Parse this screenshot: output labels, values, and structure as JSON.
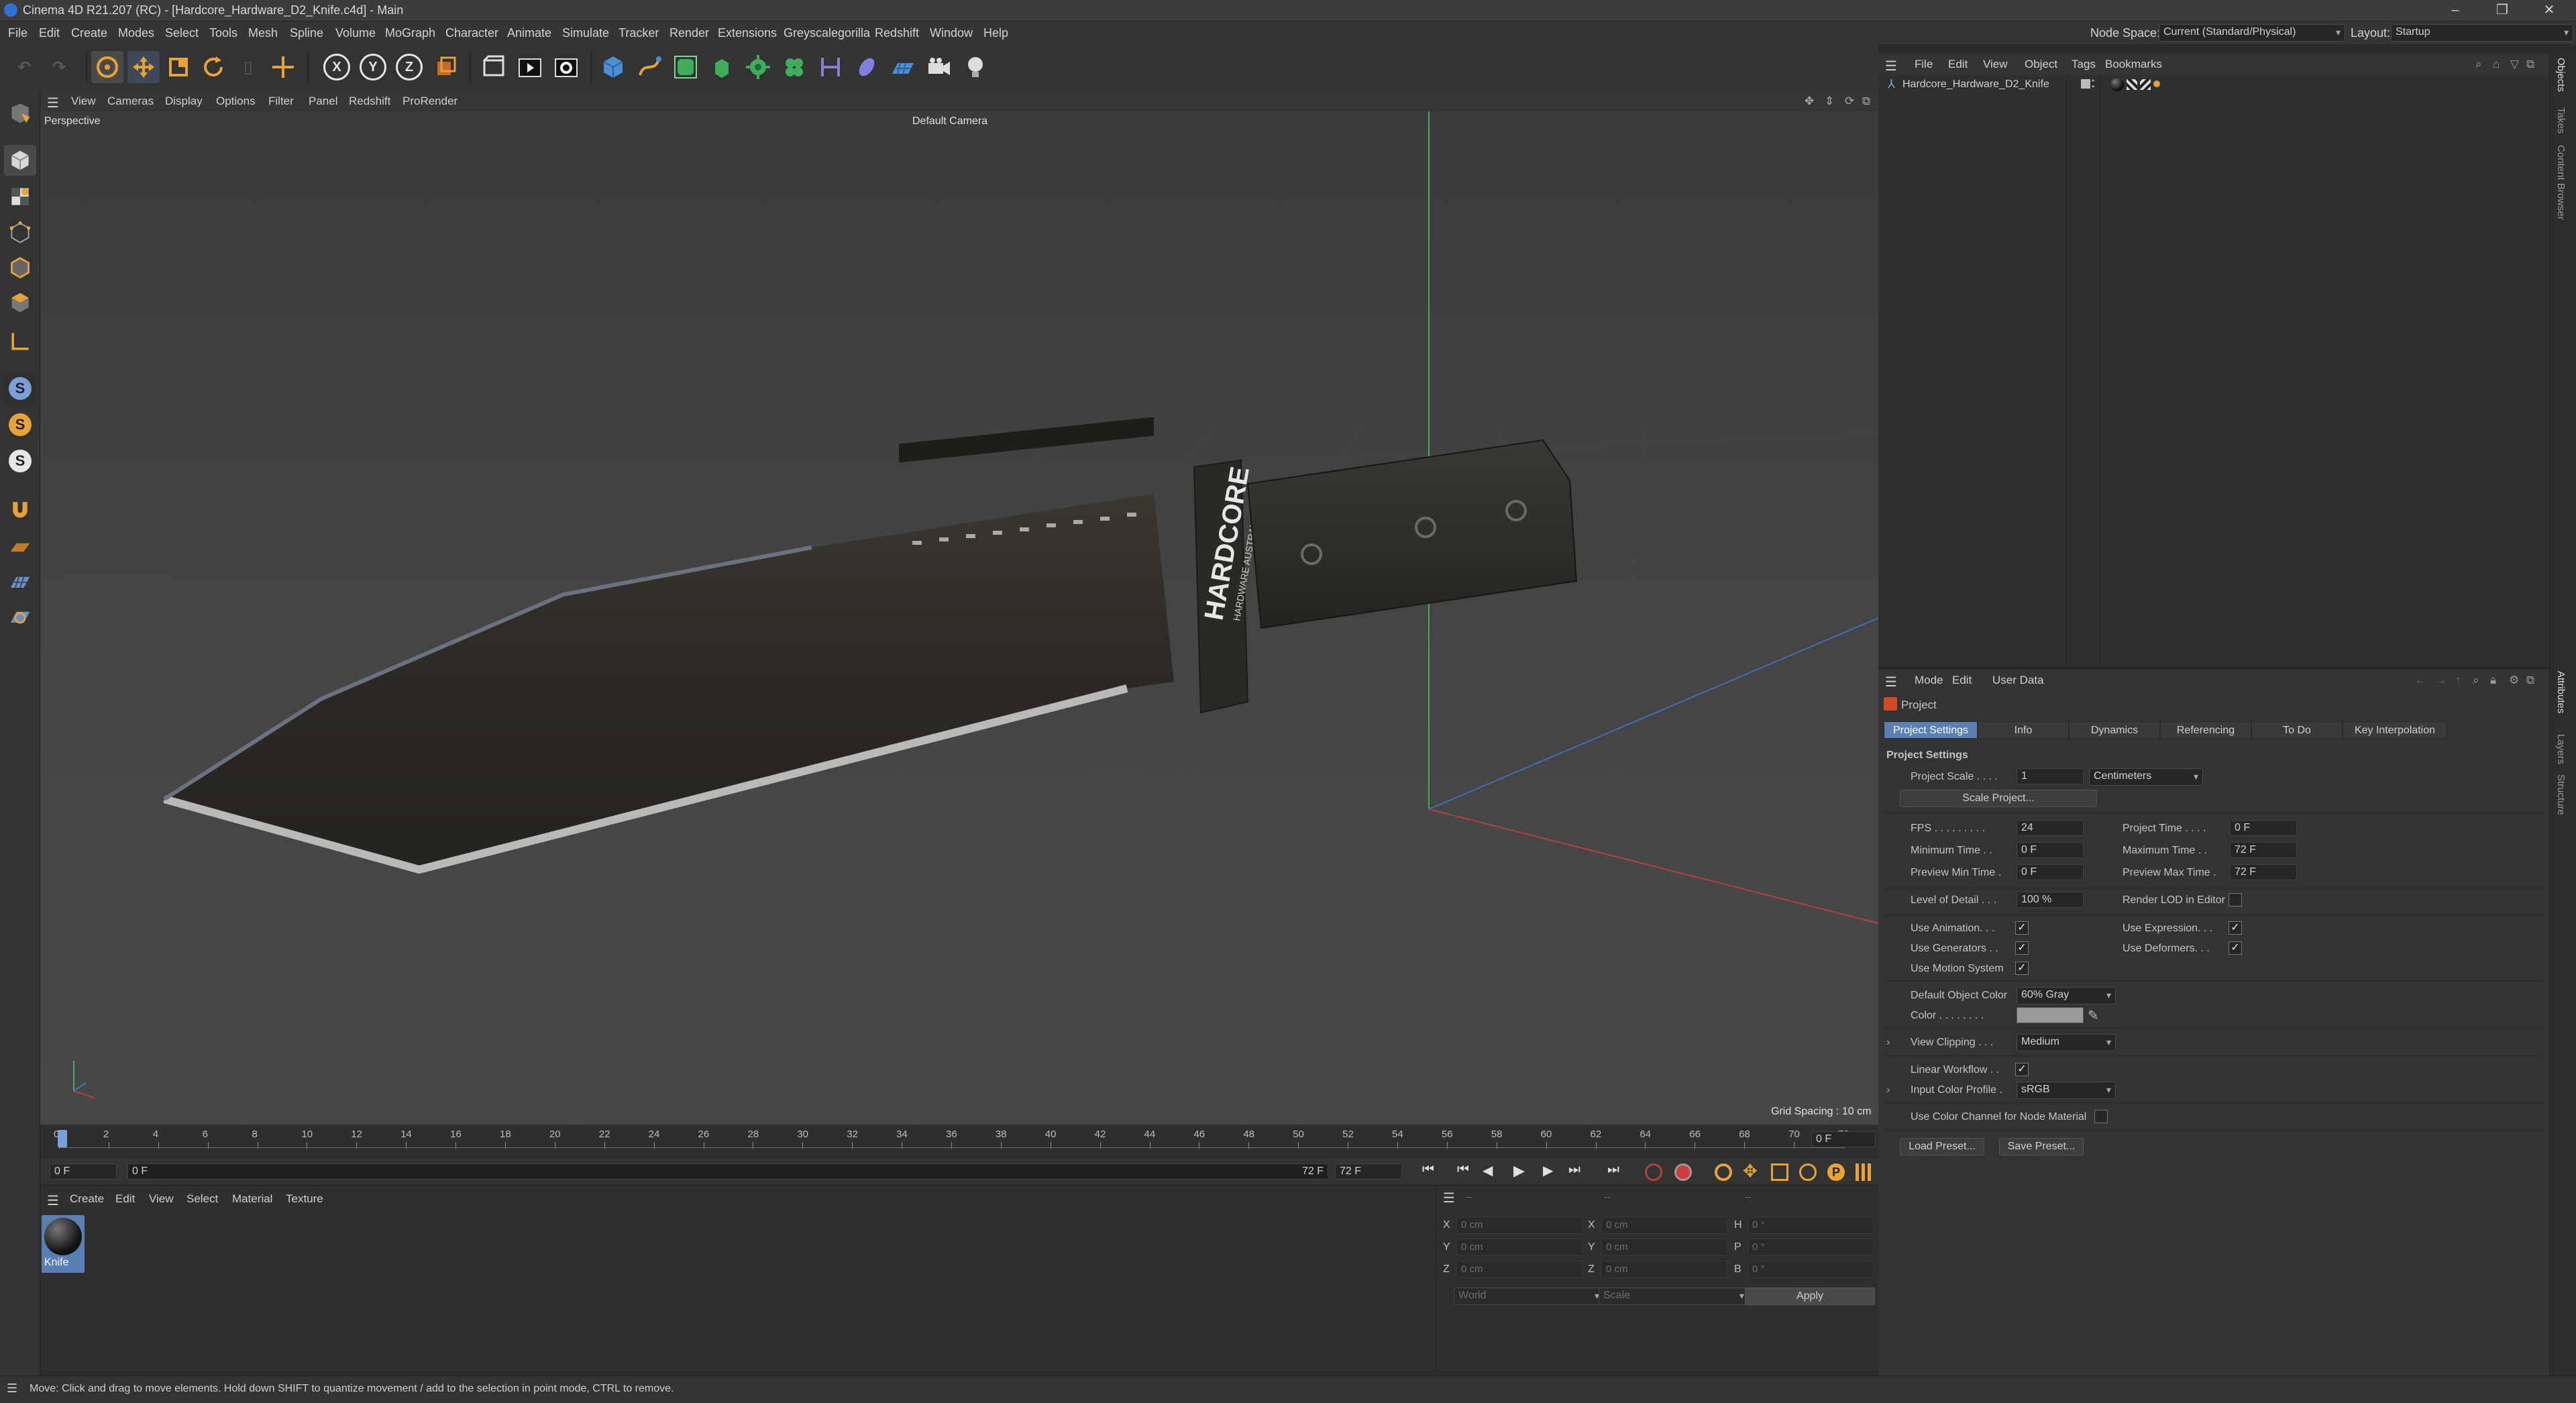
{
  "window": {
    "title": "Cinema 4D R21.207 (RC) - [Hardcore_Hardware_D2_Knife.c4d] - Main",
    "controls": [
      "–",
      "❐",
      "✕"
    ]
  },
  "menubar": {
    "items": [
      "File",
      "Edit",
      "Create",
      "Modes",
      "Select",
      "Tools",
      "Mesh",
      "Spline",
      "Volume",
      "MoGraph",
      "Character",
      "Animate",
      "Simulate",
      "Tracker",
      "Render",
      "Extensions",
      "Greyscalegorilla",
      "Redshift",
      "Window",
      "Help"
    ],
    "node_space_label": "Node Space:",
    "node_space_value": "Current (Standard/Physical)",
    "layout_label": "Layout:",
    "layout_value": "Startup"
  },
  "toolbar": {
    "axis_x": "X",
    "axis_y": "Y",
    "axis_z": "Z"
  },
  "left_palette": {
    "s_labels": [
      "S",
      "S",
      "S"
    ]
  },
  "viewport": {
    "menu": [
      "View",
      "Cameras",
      "Display",
      "Options",
      "Filter",
      "Panel",
      "Redshift",
      "ProRender"
    ],
    "projection": "Perspective",
    "camera": "Default Camera",
    "grid_spacing": "Grid Spacing : 10 cm",
    "knife_brand_1": "HARDCORE",
    "knife_brand_2": "HARDWARE AUSTRALIA"
  },
  "timeline": {
    "ticks": [
      "0",
      "2",
      "4",
      "6",
      "8",
      "10",
      "12",
      "14",
      "16",
      "18",
      "20",
      "22",
      "24",
      "26",
      "28",
      "30",
      "32",
      "34",
      "36",
      "38",
      "40",
      "42",
      "44",
      "46",
      "48",
      "50",
      "52",
      "54",
      "56",
      "58",
      "60",
      "62",
      "64",
      "66",
      "68",
      "70",
      "72"
    ],
    "current_frame": "0 F",
    "start": "0 F",
    "range_start": "0 F",
    "range_end": "72 F",
    "end": "72 F"
  },
  "material_manager": {
    "menu": [
      "Create",
      "Edit",
      "View",
      "Select",
      "Material",
      "Texture"
    ],
    "material_name": "Knife"
  },
  "coordinates": {
    "rows": [
      {
        "a": "X",
        "av": "0 cm",
        "b": "X",
        "bv": "0 cm",
        "c": "H",
        "cv": "0 °"
      },
      {
        "a": "Y",
        "av": "0 cm",
        "b": "Y",
        "bv": "0 cm",
        "c": "P",
        "cv": "0 °"
      },
      {
        "a": "Z",
        "av": "0 cm",
        "b": "Z",
        "bv": "0 cm",
        "c": "B",
        "cv": "0 °"
      }
    ],
    "space": "World",
    "mode": "Scale",
    "apply": "Apply",
    "header_dashes": "--"
  },
  "status": "Move: Click and drag to move elements. Hold down SHIFT to quantize movement / add to the selection in point mode, CTRL to remove.",
  "object_manager": {
    "menu": [
      "File",
      "Edit",
      "View",
      "Object",
      "Tags",
      "Bookmarks"
    ],
    "object_name": "Hardcore_Hardware_D2_Knife"
  },
  "right_tabs": [
    "Objects",
    "Takes",
    "Content Browser",
    "Attributes",
    "Layers",
    "Structure"
  ],
  "attributes": {
    "menu": [
      "Mode",
      "Edit",
      "User Data"
    ],
    "title": "Project",
    "tabs": [
      "Project Settings",
      "Info",
      "Dynamics",
      "Referencing",
      "To Do",
      "Key Interpolation"
    ],
    "section": "Project Settings",
    "project_scale_label": "Project Scale . . . .",
    "project_scale_value": "1",
    "project_scale_unit": "Centimeters",
    "scale_project_button": "Scale Project...",
    "fps_label": "FPS . . . . . . . . .",
    "fps_value": "24",
    "project_time_label": "Project Time . . . .",
    "project_time_value": "0 F",
    "min_time_label": "Minimum Time . .",
    "min_time_value": "0 F",
    "max_time_label": "Maximum Time . .",
    "max_time_value": "72 F",
    "prev_min_label": "Preview Min Time .",
    "prev_min_value": "0 F",
    "prev_max_label": "Preview Max Time .",
    "prev_max_value": "72 F",
    "lod_label": "Level of Detail . . .",
    "lod_value": "100 %",
    "render_lod_label": "Render LOD in Editor",
    "use_animation_label": "Use Animation. . .",
    "use_expression_label": "Use Expression. . .",
    "use_generators_label": "Use Generators . .",
    "use_deformers_label": "Use Deformers. . .",
    "use_motion_label": "Use Motion System",
    "default_color_label": "Default Object Color",
    "default_color_value": "60% Gray",
    "color_label": "Color . . . . . . . .",
    "view_clipping_label": "View Clipping . . .",
    "view_clipping_value": "Medium",
    "linear_workflow_label": "Linear Workflow . .",
    "input_profile_label": "Input Color Profile .",
    "input_profile_value": "sRGB",
    "color_channel_label": "Use Color Channel for Node Material",
    "load_preset": "Load Preset...",
    "save_preset": "Save Preset...",
    "check_mark": "✓"
  },
  "colors": {
    "accent_blue": "#5a7fb5",
    "axis_green": "#3fae5a",
    "axis_red": "#b54040",
    "axis_blue": "#3f6fb8",
    "swatch_gray": "#999999"
  }
}
